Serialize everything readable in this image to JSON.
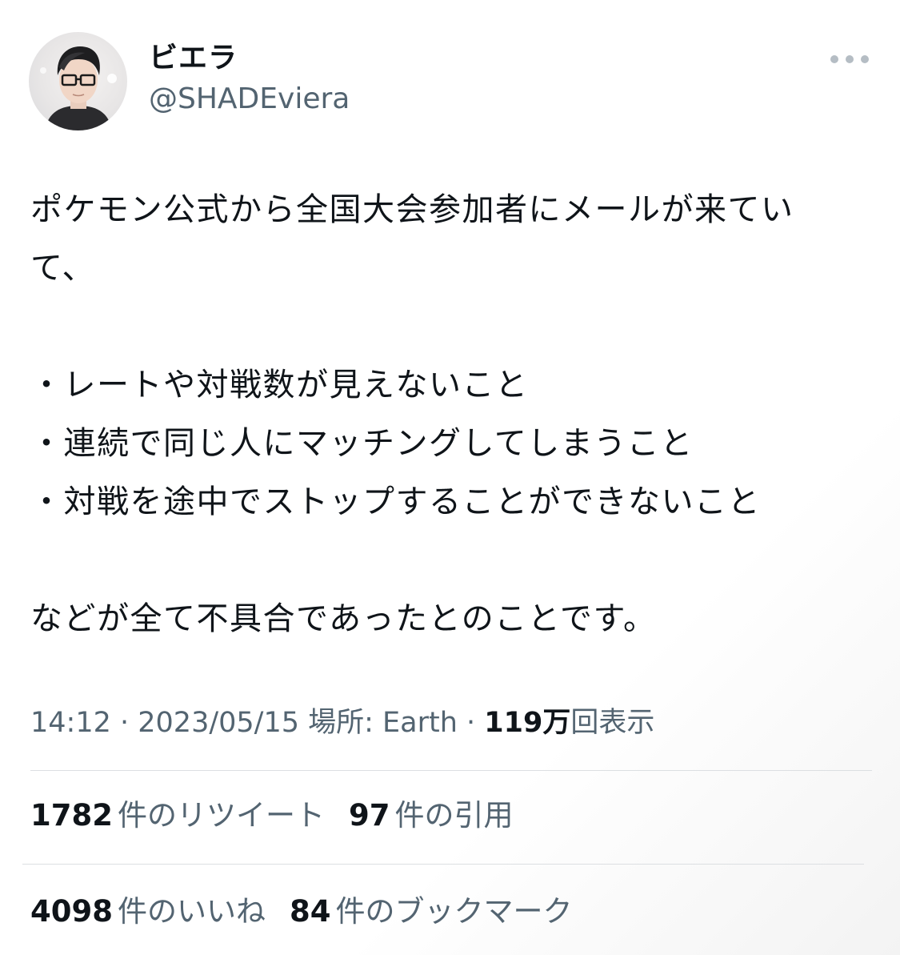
{
  "user": {
    "display_name": "ビエラ",
    "handle": "@SHADEviera"
  },
  "tweet": {
    "lines": [
      "ポケモン公式から全国大会参加者にメールが来てい",
      "て、",
      "・レートや対戦数が見えないこと",
      "・連続で同じ人にマッチングしてしまうこと",
      "・対戦を途中でストップすることができないこと",
      "などが全て不具合であったとのことです。"
    ]
  },
  "meta": {
    "time": "14:12",
    "separator": " · ",
    "date": "2023/05/15",
    "location": " 場所: Earth",
    "views_number": "119万",
    "views_label": "回表示"
  },
  "stats": {
    "retweets_count": "1782",
    "retweets_label": "件のリツイート",
    "quotes_count": "97",
    "quotes_label": "件の引用",
    "likes_count": "4098",
    "likes_label": "件のいいね",
    "bookmarks_count": "84",
    "bookmarks_label": "件のブックマーク"
  },
  "icons": {
    "more": "more-horizontal-icon"
  },
  "colors": {
    "text": "#0f1419",
    "secondary": "#536471",
    "divider": "#dcdfe2"
  }
}
